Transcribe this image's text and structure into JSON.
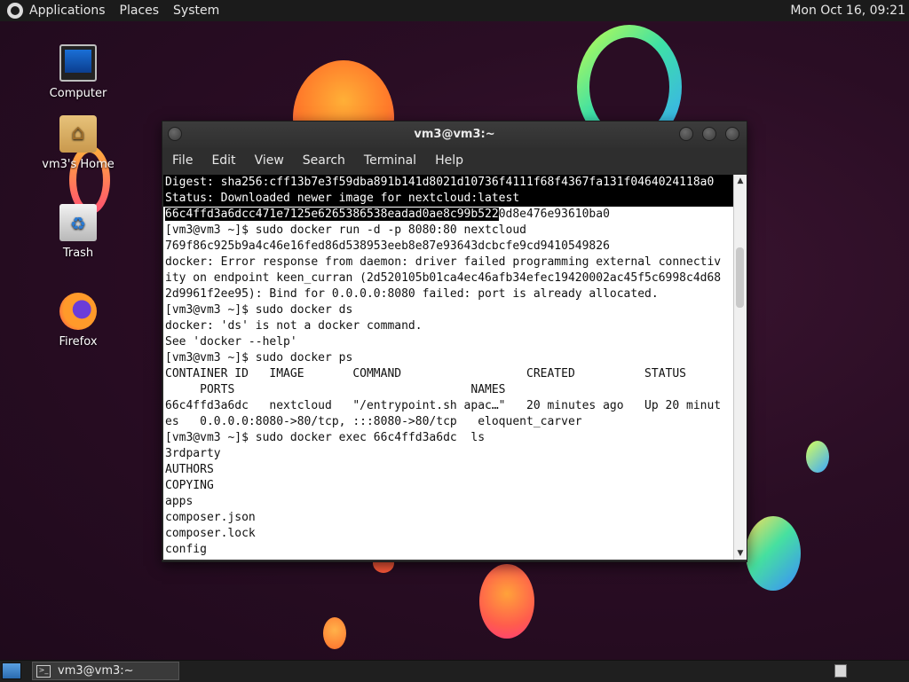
{
  "top_panel": {
    "menus": [
      "Applications",
      "Places",
      "System"
    ],
    "clock": "Mon Oct 16, 09:21"
  },
  "desktop_icons": [
    {
      "label": "Computer",
      "icon": "computer-icon"
    },
    {
      "label": "vm3's Home",
      "icon": "home-folder-icon"
    },
    {
      "label": "Trash",
      "icon": "trash-icon"
    },
    {
      "label": "Firefox",
      "icon": "firefox-icon"
    }
  ],
  "terminal": {
    "title": "vm3@vm3:~",
    "menus": [
      "File",
      "Edit",
      "View",
      "Search",
      "Terminal",
      "Help"
    ],
    "lines": [
      "Digest: sha256:cff13b7e3f59dba891b141d8021d10736f4111f68f4367fa131f0464024118a0",
      "Status: Downloaded newer image for nextcloud:latest",
      "66c4ffd3a6dcc471e7125e6265386538eadad0ae8c99b522",
      "[vm3@vm3 ~]$ sudo docker run -d -p 8080:80 nextcloud",
      "769f86c925b9a4c46e16fed86d538953eeb8e87e93643dcbcfe9cd9410549826",
      "docker: Error response from daemon: driver failed programming external connectiv",
      "ity on endpoint keen_curran (2d520105b01ca4ec46afb34efec19420002ac45f5c6998c4d68",
      "2d9961f2ee95): Bind for 0.0.0.0:8080 failed: port is already allocated.",
      "[vm3@vm3 ~]$ sudo docker ds",
      "docker: 'ds' is not a docker command.",
      "See 'docker --help'",
      "[vm3@vm3 ~]$ sudo docker ps",
      "CONTAINER ID   IMAGE       COMMAND                  CREATED          STATUS",
      "     PORTS                                  NAMES",
      "66c4ffd3a6dc   nextcloud   \"/entrypoint.sh apac…\"   20 minutes ago   Up 20 minut",
      "es   0.0.0.0:8080->80/tcp, :::8080->80/tcp   eloquent_carver",
      "[vm3@vm3 ~]$ sudo docker exec 66c4ffd3a6dc  ls",
      "3rdparty",
      "AUTHORS",
      "COPYING",
      "apps",
      "composer.json",
      "composer.lock",
      "config"
    ],
    "line2_tail": "0d8e476e93610ba0"
  },
  "bottom_panel": {
    "task_label": "vm3@vm3:~"
  }
}
